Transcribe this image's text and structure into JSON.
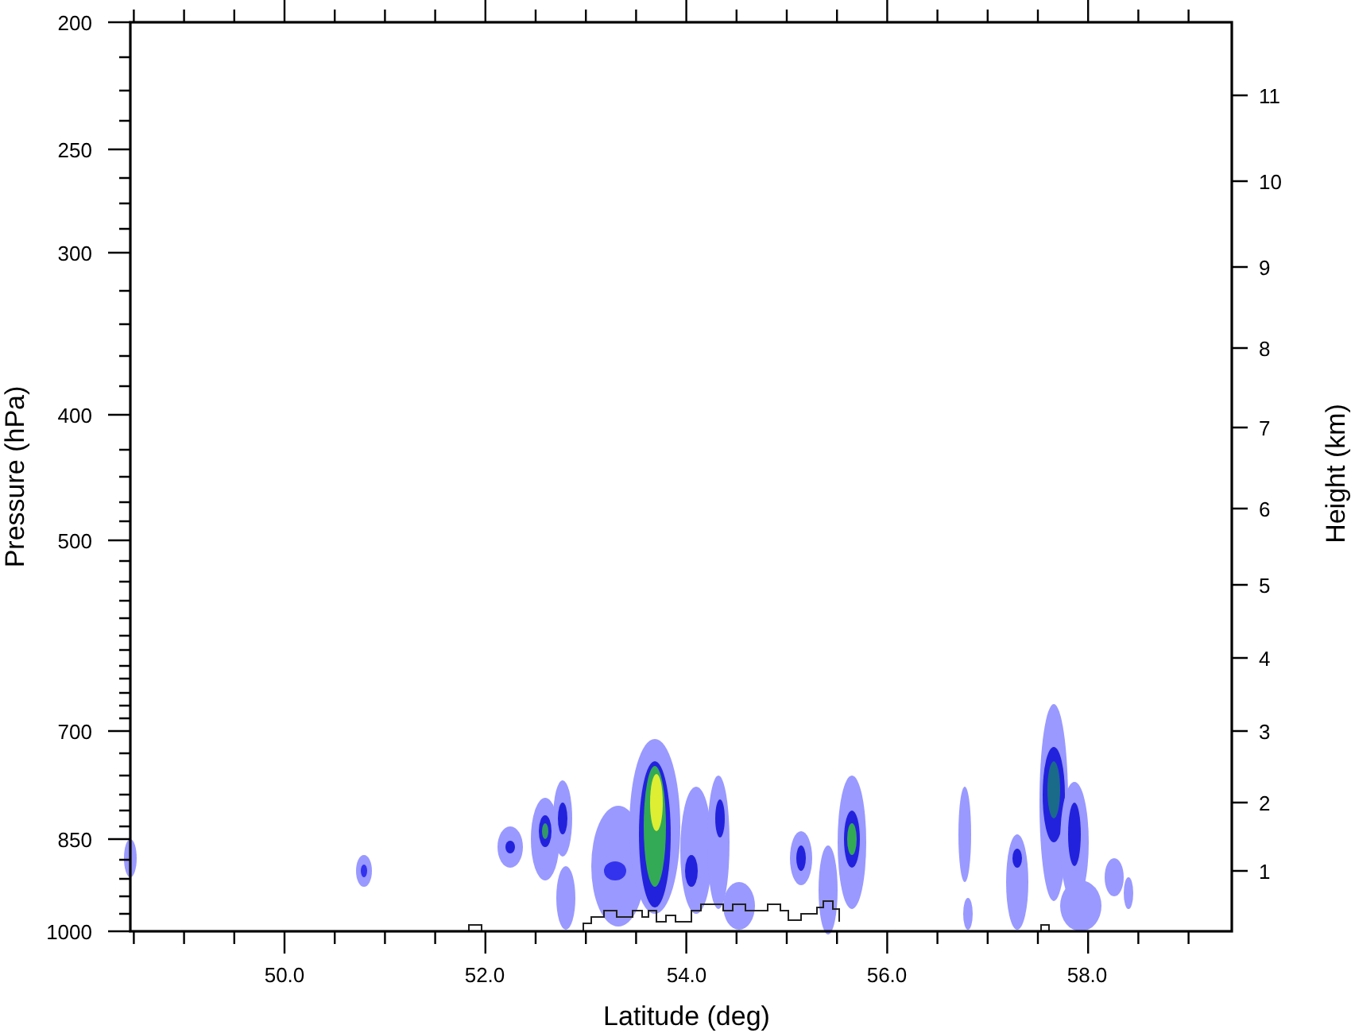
{
  "plot": {
    "y_axis_left": {
      "label": "Pressure (hPa)",
      "ticks": [
        "200",
        "250",
        "300",
        "400",
        "500",
        "700",
        "850",
        "1000"
      ]
    },
    "y_axis_right": {
      "label": "Height (km)",
      "ticks": [
        "11",
        "10",
        "9",
        "8",
        "7",
        "6",
        "5",
        "4",
        "3",
        "2",
        "1"
      ]
    },
    "x_axis": {
      "label": "Latitude (deg)",
      "ticks": [
        "50.0",
        "52.0",
        "54.0",
        "56.0",
        "58.0"
      ]
    }
  }
}
